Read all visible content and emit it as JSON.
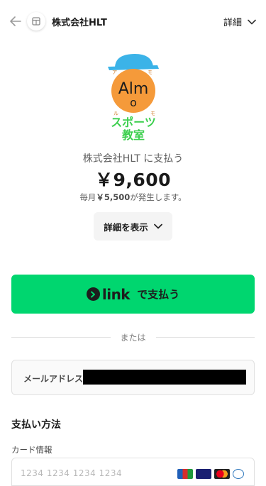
{
  "header": {
    "merchant_name": "株式会社HLT",
    "details_label": "詳細"
  },
  "logo": {
    "line1": "Alm",
    "line2": "o",
    "small_left": "ア",
    "small_top_right": "モ",
    "small_ru": "ル",
    "small_mo": "モ",
    "line3": "スポーツ",
    "line4": "教室"
  },
  "summary": {
    "pay_to": "株式会社HLT に支払う",
    "amount": "￥9,600",
    "recurring_prefix": "毎月",
    "recurring_amount": "￥5,500",
    "recurring_suffix": "が発生します。",
    "show_details_label": "詳細を表示"
  },
  "link_pay": {
    "link_word": "link",
    "suffix": "で支払う"
  },
  "divider_text": "または",
  "email": {
    "label": "メールアドレス"
  },
  "payment": {
    "section_title": "支払い方法",
    "card_label": "カード情報",
    "card_placeholder": "1234 1234 1234 1234",
    "brands": [
      "jcb-icon",
      "visa-icon",
      "mastercard-icon",
      "amex-icon"
    ]
  },
  "colors": {
    "link_green": "#00d66f",
    "logo_orange": "#f59a3a",
    "logo_cap": "#3bb3e8",
    "logo_green": "#3ccf4e"
  }
}
